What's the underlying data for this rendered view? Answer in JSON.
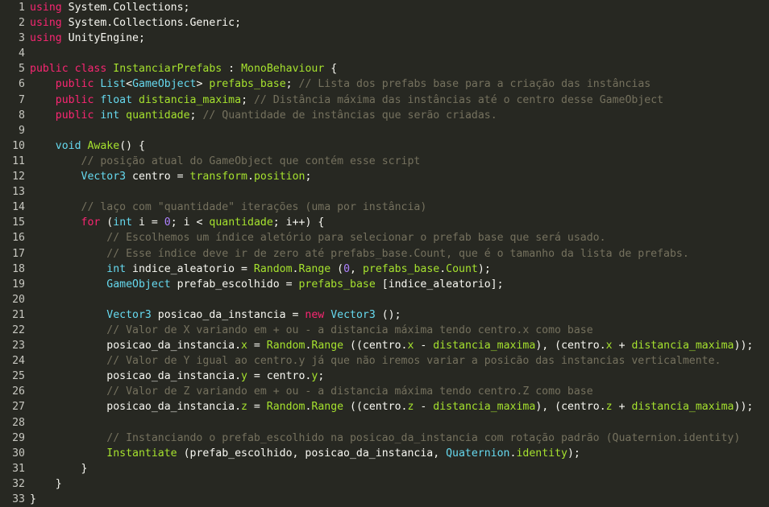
{
  "editor": {
    "lines": [
      {
        "n": "1",
        "tokens": [
          [
            "kw",
            "using"
          ],
          [
            "pl",
            " System.Collections;"
          ]
        ]
      },
      {
        "n": "2",
        "tokens": [
          [
            "kw",
            "using"
          ],
          [
            "pl",
            " System.Collections.Generic;"
          ]
        ]
      },
      {
        "n": "3",
        "tokens": [
          [
            "kw",
            "using"
          ],
          [
            "pl",
            " UnityEngine;"
          ]
        ]
      },
      {
        "n": "4",
        "tokens": []
      },
      {
        "n": "5",
        "tokens": [
          [
            "kw",
            "public"
          ],
          [
            "pl",
            " "
          ],
          [
            "kw",
            "class"
          ],
          [
            "pl",
            " "
          ],
          [
            "fn",
            "InstanciarPrefabs"
          ],
          [
            "pl",
            " : "
          ],
          [
            "fn",
            "MonoBehaviour"
          ],
          [
            "pl",
            " {"
          ]
        ]
      },
      {
        "n": "6",
        "tokens": [
          [
            "pl",
            "    "
          ],
          [
            "kw",
            "public"
          ],
          [
            "pl",
            " "
          ],
          [
            "ty",
            "List"
          ],
          [
            "pl",
            "<"
          ],
          [
            "ty",
            "GameObject"
          ],
          [
            "pl",
            "> "
          ],
          [
            "fn",
            "prefabs_base"
          ],
          [
            "pl",
            "; "
          ],
          [
            "cm",
            "// Lista dos prefabs base para a criação das instâncias"
          ]
        ]
      },
      {
        "n": "7",
        "tokens": [
          [
            "pl",
            "    "
          ],
          [
            "kw",
            "public"
          ],
          [
            "pl",
            " "
          ],
          [
            "ty",
            "float"
          ],
          [
            "pl",
            " "
          ],
          [
            "fn",
            "distancia_maxima"
          ],
          [
            "pl",
            "; "
          ],
          [
            "cm",
            "// Distância máxima das instâncias até o centro desse GameObject"
          ]
        ]
      },
      {
        "n": "8",
        "tokens": [
          [
            "pl",
            "    "
          ],
          [
            "kw",
            "public"
          ],
          [
            "pl",
            " "
          ],
          [
            "ty",
            "int"
          ],
          [
            "pl",
            " "
          ],
          [
            "fn",
            "quantidade"
          ],
          [
            "pl",
            "; "
          ],
          [
            "cm",
            "// Quantidade de instâncias que serão criadas."
          ]
        ]
      },
      {
        "n": "9",
        "tokens": []
      },
      {
        "n": "10",
        "tokens": [
          [
            "pl",
            "    "
          ],
          [
            "ty",
            "void"
          ],
          [
            "pl",
            " "
          ],
          [
            "fn",
            "Awake"
          ],
          [
            "pl",
            "() {"
          ]
        ]
      },
      {
        "n": "11",
        "tokens": [
          [
            "pl",
            "        "
          ],
          [
            "cm",
            "// posição atual do GameObject que contém esse script"
          ]
        ]
      },
      {
        "n": "12",
        "tokens": [
          [
            "pl",
            "        "
          ],
          [
            "ty",
            "Vector3"
          ],
          [
            "pl",
            " centro = "
          ],
          [
            "fn",
            "transform"
          ],
          [
            "pl",
            "."
          ],
          [
            "fn",
            "position"
          ],
          [
            "pl",
            ";"
          ]
        ]
      },
      {
        "n": "13",
        "tokens": []
      },
      {
        "n": "14",
        "tokens": [
          [
            "pl",
            "        "
          ],
          [
            "cm",
            "// laço com \"quantidade\" iterações (uma por instância)"
          ]
        ]
      },
      {
        "n": "15",
        "tokens": [
          [
            "pl",
            "        "
          ],
          [
            "kw",
            "for"
          ],
          [
            "pl",
            " ("
          ],
          [
            "ty",
            "int"
          ],
          [
            "pl",
            " i = "
          ],
          [
            "nu",
            "0"
          ],
          [
            "pl",
            "; i < "
          ],
          [
            "fn",
            "quantidade"
          ],
          [
            "pl",
            "; i++) {"
          ]
        ]
      },
      {
        "n": "16",
        "tokens": [
          [
            "pl",
            "            "
          ],
          [
            "cm",
            "// Escolhemos um índice aletório para selecionar o prefab base que será usado."
          ]
        ]
      },
      {
        "n": "17",
        "tokens": [
          [
            "pl",
            "            "
          ],
          [
            "cm",
            "// Esse índice deve ir de zero até prefabs_base.Count, que é o tamanho da lista de prefabs."
          ]
        ]
      },
      {
        "n": "18",
        "tokens": [
          [
            "pl",
            "            "
          ],
          [
            "ty",
            "int"
          ],
          [
            "pl",
            " indice_aleatorio = "
          ],
          [
            "fn",
            "Random"
          ],
          [
            "pl",
            "."
          ],
          [
            "fn",
            "Range"
          ],
          [
            "pl",
            " ("
          ],
          [
            "nu",
            "0"
          ],
          [
            "pl",
            ", "
          ],
          [
            "fn",
            "prefabs_base"
          ],
          [
            "pl",
            "."
          ],
          [
            "fn",
            "Count"
          ],
          [
            "pl",
            ");"
          ]
        ]
      },
      {
        "n": "19",
        "tokens": [
          [
            "pl",
            "            "
          ],
          [
            "ty",
            "GameObject"
          ],
          [
            "pl",
            " prefab_escolhido = "
          ],
          [
            "fn",
            "prefabs_base"
          ],
          [
            "pl",
            " [indice_aleatorio];"
          ]
        ]
      },
      {
        "n": "20",
        "tokens": []
      },
      {
        "n": "21",
        "tokens": [
          [
            "pl",
            "            "
          ],
          [
            "ty",
            "Vector3"
          ],
          [
            "pl",
            " posicao_da_instancia = "
          ],
          [
            "kw",
            "new"
          ],
          [
            "pl",
            " "
          ],
          [
            "ty",
            "Vector3"
          ],
          [
            "pl",
            " ();"
          ]
        ]
      },
      {
        "n": "22",
        "tokens": [
          [
            "pl",
            "            "
          ],
          [
            "cm",
            "// Valor de X variando em + ou - a distancia máxima tendo centro.x como base"
          ]
        ]
      },
      {
        "n": "23",
        "tokens": [
          [
            "pl",
            "            posicao_da_instancia."
          ],
          [
            "fn",
            "x"
          ],
          [
            "pl",
            " = "
          ],
          [
            "fn",
            "Random"
          ],
          [
            "pl",
            "."
          ],
          [
            "fn",
            "Range"
          ],
          [
            "pl",
            " ((centro."
          ],
          [
            "fn",
            "x"
          ],
          [
            "pl",
            " - "
          ],
          [
            "fn",
            "distancia_maxima"
          ],
          [
            "pl",
            "), (centro."
          ],
          [
            "fn",
            "x"
          ],
          [
            "pl",
            " + "
          ],
          [
            "fn",
            "distancia_maxima"
          ],
          [
            "pl",
            "));"
          ]
        ]
      },
      {
        "n": "24",
        "tokens": [
          [
            "pl",
            "            "
          ],
          [
            "cm",
            "// Valor de Y igual ao centro.y já que não iremos variar a posicão das instancias verticalmente."
          ]
        ]
      },
      {
        "n": "25",
        "tokens": [
          [
            "pl",
            "            posicao_da_instancia."
          ],
          [
            "fn",
            "y"
          ],
          [
            "pl",
            " = centro."
          ],
          [
            "fn",
            "y"
          ],
          [
            "pl",
            ";"
          ]
        ]
      },
      {
        "n": "26",
        "tokens": [
          [
            "pl",
            "            "
          ],
          [
            "cm",
            "// Valor de Z variando em + ou - a distancia máxima tendo centro.Z como base"
          ]
        ]
      },
      {
        "n": "27",
        "tokens": [
          [
            "pl",
            "            posicao_da_instancia."
          ],
          [
            "fn",
            "z"
          ],
          [
            "pl",
            " = "
          ],
          [
            "fn",
            "Random"
          ],
          [
            "pl",
            "."
          ],
          [
            "fn",
            "Range"
          ],
          [
            "pl",
            " ((centro."
          ],
          [
            "fn",
            "z"
          ],
          [
            "pl",
            " - "
          ],
          [
            "fn",
            "distancia_maxima"
          ],
          [
            "pl",
            "), (centro."
          ],
          [
            "fn",
            "z"
          ],
          [
            "pl",
            " + "
          ],
          [
            "fn",
            "distancia_maxima"
          ],
          [
            "pl",
            "));"
          ]
        ]
      },
      {
        "n": "28",
        "tokens": []
      },
      {
        "n": "29",
        "tokens": [
          [
            "pl",
            "            "
          ],
          [
            "cm",
            "// Instanciando o prefab_escolhido na posicao_da_instancia com rotação padrão (Quaternion.identity)"
          ]
        ]
      },
      {
        "n": "30",
        "tokens": [
          [
            "pl",
            "            "
          ],
          [
            "fn",
            "Instantiate"
          ],
          [
            "pl",
            " (prefab_escolhido, posicao_da_instancia, "
          ],
          [
            "ty",
            "Quaternion"
          ],
          [
            "pl",
            "."
          ],
          [
            "fn",
            "identity"
          ],
          [
            "pl",
            ");"
          ]
        ]
      },
      {
        "n": "31",
        "tokens": [
          [
            "pl",
            "        }"
          ]
        ]
      },
      {
        "n": "32",
        "tokens": [
          [
            "pl",
            "    }"
          ]
        ]
      },
      {
        "n": "33",
        "tokens": [
          [
            "pl",
            "}"
          ]
        ]
      }
    ]
  }
}
